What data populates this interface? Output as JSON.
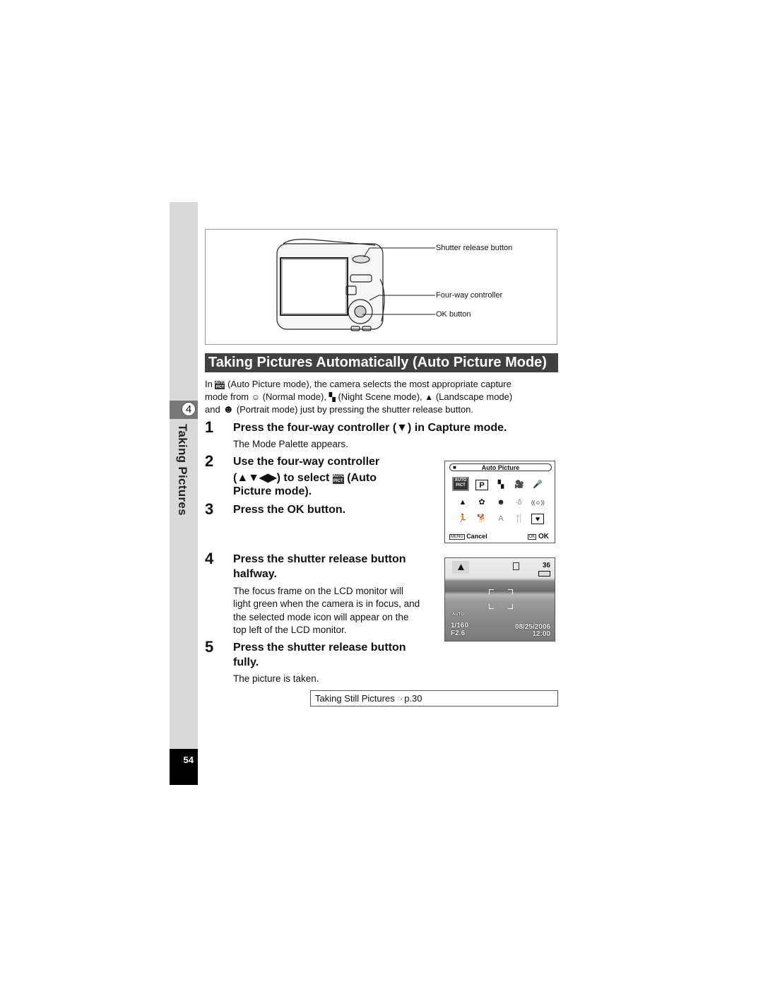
{
  "sidebar": {
    "chapter_number": "4",
    "chapter_title": "Taking Pictures",
    "page_number": "54"
  },
  "figure": {
    "callouts": [
      "Shutter release button",
      "Four-way controller",
      "OK button"
    ]
  },
  "title": "Taking Pictures Automatically (Auto Picture Mode)",
  "intro": {
    "line1_a": "In",
    "line1_b": "(Auto Picture mode), the camera selects the most appropriate capture",
    "line2_a": "mode from",
    "line2_b": "(Normal mode),",
    "line2_c": "(Night Scene mode),",
    "line2_d": "(Landscape mode)",
    "line3_a": "and",
    "line3_b": "(Portrait mode) just by pressing the shutter release button."
  },
  "icons": {
    "auto_pict": "AUTO PICT",
    "normal": "☺",
    "night_scene": "▚",
    "landscape": "▲",
    "portrait": "☻"
  },
  "steps": [
    {
      "num": "1",
      "text": "Press the four-way controller (▼) in Capture mode.",
      "desc": [
        "The Mode Palette appears."
      ]
    },
    {
      "num": "2",
      "text_lines": [
        "Use the four-way controller",
        "(▲▼◀▶) to select",
        "(Auto",
        "Picture mode)."
      ]
    },
    {
      "num": "3",
      "text": "Press the OK button."
    },
    {
      "num": "4",
      "text_lines": [
        "Press the shutter release button",
        "halfway."
      ],
      "desc": [
        "The focus frame on the LCD monitor will",
        "light green when the camera is in focus, and",
        "the selected mode icon will appear on the",
        "top left of the LCD monitor."
      ]
    },
    {
      "num": "5",
      "text_lines": [
        "Press the shutter release button",
        "fully."
      ],
      "desc": [
        "The picture is taken."
      ]
    }
  ],
  "mode_palette": {
    "header": "Auto Picture",
    "rows": [
      [
        "AUTO PICT",
        "P",
        "▚",
        "🎥",
        "🎤"
      ],
      [
        "▲",
        "✿",
        "☻",
        "☃",
        "((☺))"
      ],
      [
        "🏃",
        "🐕",
        "A",
        "🍴",
        "♥"
      ]
    ],
    "cancel_key": "MENU",
    "cancel_label": "Cancel",
    "ok_key": "OK",
    "ok_label": "OK"
  },
  "lcd": {
    "shots_remaining": "36",
    "shutter_speed": "1/160",
    "aperture": "F2.6",
    "date": "08/25/2006",
    "time": "12:00",
    "stabilizer": "AUTO"
  },
  "reference": {
    "text": "Taking Still Pictures",
    "arrow": "☞",
    "page": "p.30"
  }
}
